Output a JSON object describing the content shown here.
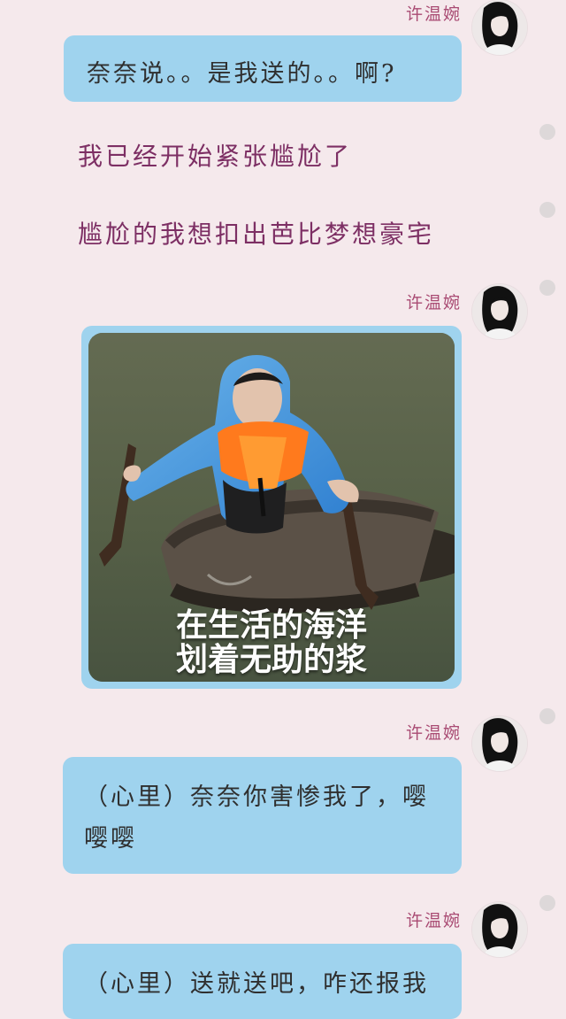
{
  "messages": [
    {
      "sender": "许温婉",
      "text": "奈奈说。。是我送的。。啊?"
    },
    {
      "narration": "我已经开始紧张尴尬了"
    },
    {
      "narration": "尴尬的我想扣出芭比梦想豪宅"
    },
    {
      "sender": "许温婉",
      "image_caption_lines": [
        "在生活的海洋",
        "划着无助的浆"
      ]
    },
    {
      "sender": "许温婉",
      "text": "（心里）奈奈你害惨我了，嘤嘤嘤"
    },
    {
      "sender": "许温婉",
      "text": "（心里）送就送吧，咋还报我"
    }
  ],
  "colors": {
    "background": "#f5e9ec",
    "bubble": "#9fd3ee",
    "sender": "#a94b73",
    "narration": "#7d2f64"
  }
}
